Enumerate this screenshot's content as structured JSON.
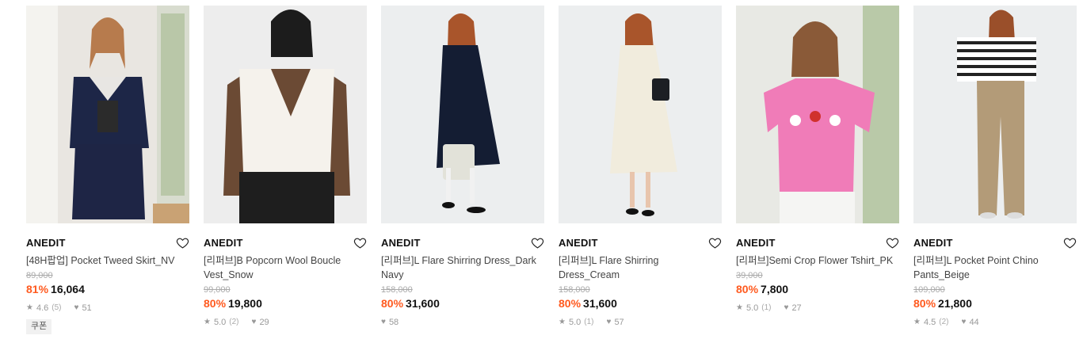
{
  "products": [
    {
      "brand": "ANEDIT",
      "title": "[48H팝업] Pocket Tweed Skirt_NV",
      "original_price": "89,000",
      "discount": "81%",
      "price": "16,064",
      "rating": "4.6",
      "reviews": "(5)",
      "likes": "51",
      "badge": "쿠폰"
    },
    {
      "brand": "ANEDIT",
      "title": "[리퍼브]B Popcorn Wool Boucle Vest_Snow",
      "original_price": "99,000",
      "discount": "80%",
      "price": "19,800",
      "rating": "5.0",
      "reviews": "(2)",
      "likes": "29"
    },
    {
      "brand": "ANEDIT",
      "title": "[리퍼브]L Flare Shirring Dress_Dark Navy",
      "original_price": "158,000",
      "discount": "80%",
      "price": "31,600",
      "likes": "58"
    },
    {
      "brand": "ANEDIT",
      "title": "[리퍼브]L Flare Shirring Dress_Cream",
      "original_price": "158,000",
      "discount": "80%",
      "price": "31,600",
      "rating": "5.0",
      "reviews": "(1)",
      "likes": "57"
    },
    {
      "brand": "ANEDIT",
      "title": "[리퍼브]Semi Crop Flower Tshirt_PK",
      "original_price": "39,000",
      "discount": "80%",
      "price": "7,800",
      "rating": "5.0",
      "reviews": "(1)",
      "likes": "27"
    },
    {
      "brand": "ANEDIT",
      "title": "[리퍼브]L Pocket Point Chino Pants_Beige",
      "original_price": "109,000",
      "discount": "80%",
      "price": "21,800",
      "rating": "4.5",
      "reviews": "(2)",
      "likes": "44"
    }
  ],
  "icons": {
    "like": "heart-outline-icon",
    "star": "star-icon",
    "heart_count": "heart-filled-icon"
  },
  "colors": {
    "discount": "#ff5a1f",
    "price": "#111111",
    "muted": "#999999"
  }
}
